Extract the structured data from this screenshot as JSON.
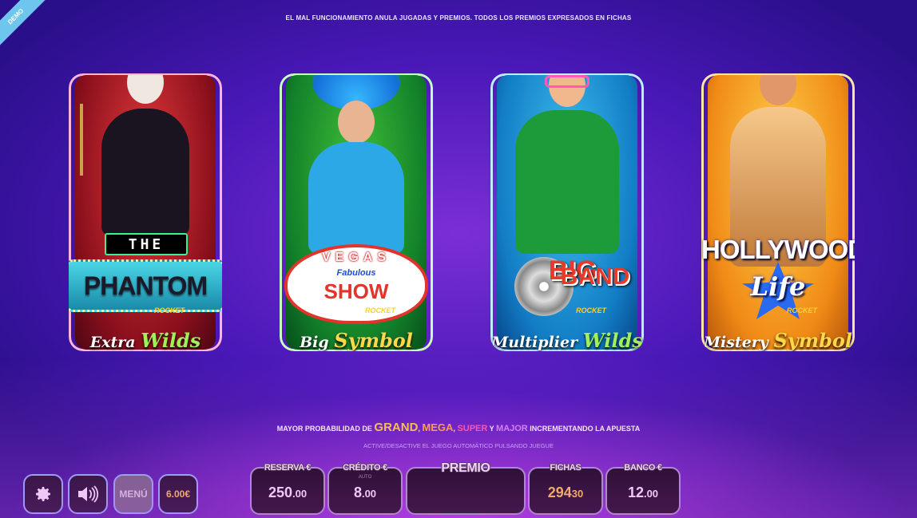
{
  "demo_badge": "DEMO",
  "disclaimer": "EL MAL FUNCIONAMIENTO ANULA JUGADAS Y PREMIOS.  TODOS LOS PREMIOS EXPRESADOS EN FICHAS",
  "games": [
    {
      "logo_top": "THE",
      "logo_main": "PHANTOM",
      "brand": "ROCKET",
      "feature_a": "Extra ",
      "feature_b": "Wilds",
      "accent": "#9ff05a"
    },
    {
      "logo_top": "VEGAS",
      "logo_mid": "Fabulous",
      "logo_main": "SHOW",
      "brand": "ROCKET",
      "feature_a": "Big ",
      "feature_b": "Symbol",
      "accent": "#ffd84a"
    },
    {
      "logo_top": "BIG",
      "logo_main": "BAND",
      "brand": "ROCKET",
      "feature_a": "Multiplier ",
      "feature_b": "Wilds",
      "accent": "#9ff05a"
    },
    {
      "logo_top": "HOLLYWOOD",
      "logo_main": "Life",
      "brand": "ROCKET",
      "feature_a": "Mistery ",
      "feature_b": "Symbol",
      "accent": "#ffd84a"
    }
  ],
  "promo": {
    "prefix": "MAYOR PROBABILIDAD DE ",
    "grand": "GRAND",
    "sep1": ", ",
    "mega": "MEGA",
    "sep2": ", ",
    "super": "SUPER",
    "y": " Y ",
    "major": "MAJOR",
    "suffix": " INCREMENTANDO LA APUESTA"
  },
  "hint": "ACTIVE/DESACTIVE  EL  JUEGO  AUTOMÁTICO  PULSANDO  JUEGUE",
  "controls": {
    "settings_icon": "gear-icon",
    "sound_icon": "speaker-icon",
    "menu_label": "MENÚ",
    "bet_label": "6.00€"
  },
  "panels": {
    "reserva": {
      "title": "RESERVA €",
      "value_int": "250",
      "value_dec": ".00"
    },
    "credito": {
      "title": "CRÉDITO €",
      "sub": "AUTO",
      "value_int": "8",
      "value_dec": ".00"
    },
    "premio": {
      "title": "PREMIO",
      "value": ""
    },
    "fichas": {
      "title": "FICHAS",
      "value_int": "294",
      "value_dec": "30"
    },
    "banco": {
      "title": "BANCO €",
      "value_int": "12",
      "value_dec": ".00"
    }
  }
}
